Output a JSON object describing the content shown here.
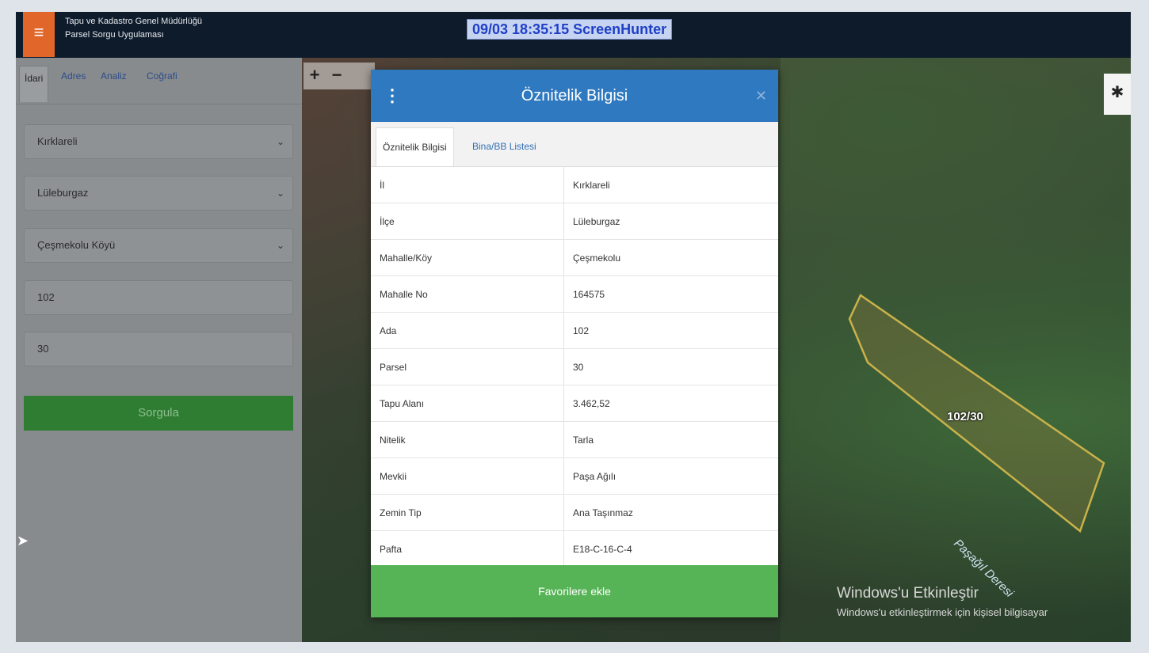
{
  "topbar": {
    "menu_icon": "hamburger-icon",
    "title_line1": "Tapu ve Kadastro Genel Müdürlüğü",
    "title_line2": "Parsel Sorgu Uygulaması",
    "screenhunter": "09/03  18:35:15  ScreenHunter"
  },
  "sidebar": {
    "tabs": [
      "İdari",
      "Adres",
      "Analiz",
      "Coğrafi"
    ],
    "il": "Kırklareli",
    "ilce": "Lüleburgaz",
    "mahalle": "Çeşmekolu Köyü",
    "ada": "102",
    "parsel": "30",
    "submit": "Sorgula"
  },
  "map": {
    "zoom_in": "+",
    "zoom_out": "−",
    "parcel_label": "102/30",
    "river_label": "Paşağıl Deresi",
    "gear_icon": "gear-icon"
  },
  "modal": {
    "title": "Öznitelik Bilgisi",
    "tabs": [
      "Öznitelik Bilgisi",
      "Bina/BB Listesi"
    ],
    "rows": [
      {
        "key": "İl",
        "value": "Kırklareli"
      },
      {
        "key": "İlçe",
        "value": "Lüleburgaz"
      },
      {
        "key": "Mahalle/Köy",
        "value": "Çeşmekolu"
      },
      {
        "key": "Mahalle No",
        "value": "164575"
      },
      {
        "key": "Ada",
        "value": "102"
      },
      {
        "key": "Parsel",
        "value": "30"
      },
      {
        "key": "Tapu Alanı",
        "value": "3.462,52"
      },
      {
        "key": "Nitelik",
        "value": "Tarla"
      },
      {
        "key": "Mevkii",
        "value": "Paşa Ağılı"
      },
      {
        "key": "Zemin Tip",
        "value": "Ana Taşınmaz"
      },
      {
        "key": "Pafta",
        "value": "E18-C-16-C-4"
      }
    ],
    "favorite_button": "Favorilere ekle"
  },
  "windows_activation": {
    "title": "Windows'u Etkinleştir",
    "subtitle": "Windows'u etkinleştirmek için kişisel bilgisayar"
  },
  "colors": {
    "header_bg": "#0e1b2b",
    "menu_orange": "#e0662a",
    "modal_header": "#2f79c0",
    "favorite_green": "#56b456",
    "sorgula_green": "#2e7d33"
  }
}
